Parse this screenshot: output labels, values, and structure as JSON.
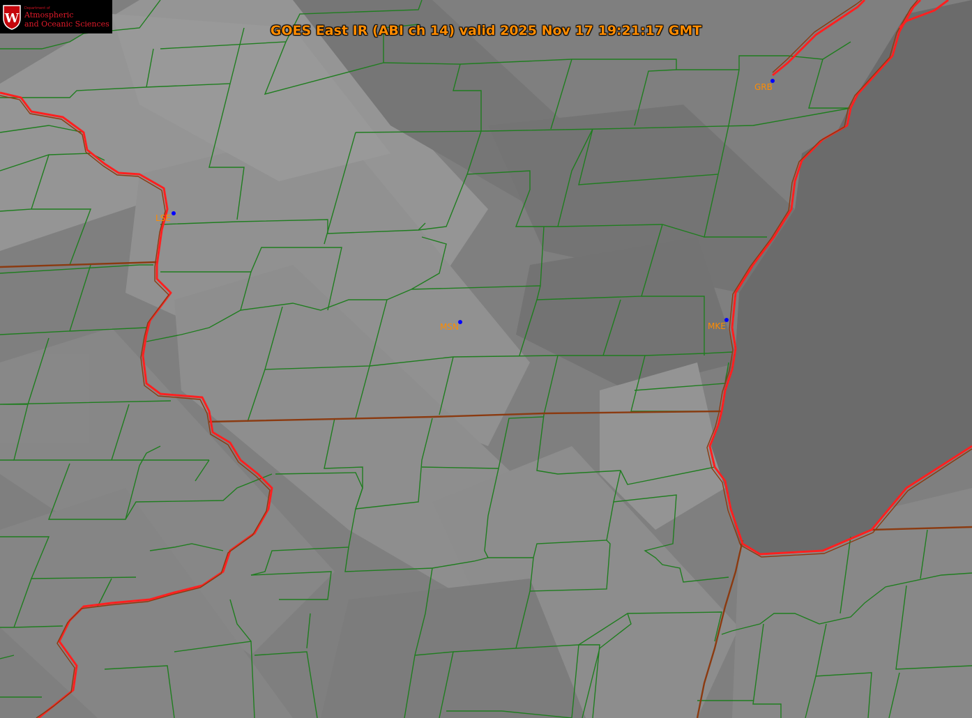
{
  "title": "GOES East IR (ABI ch 14) valid 2025 Nov 17 19:21:17 GMT",
  "logo": {
    "dept_small": "Department of",
    "line1": "Atmospheric",
    "line2": "and Oceanic Sciences",
    "shield_letter": "W"
  },
  "stations": [
    {
      "id": "LSE",
      "label": "LSE"
    },
    {
      "id": "MSN",
      "label": "MSN"
    },
    {
      "id": "MKE",
      "label": "MKE"
    },
    {
      "id": "GRB",
      "label": "GRB"
    }
  ],
  "colors": {
    "label": "#ff8c00",
    "station_dot": "#0000ff",
    "county_line": "#1a7a1a",
    "state_line": "#8b3a10",
    "coastline": "#ff2020",
    "lake_fill": "#6a6a6a"
  }
}
